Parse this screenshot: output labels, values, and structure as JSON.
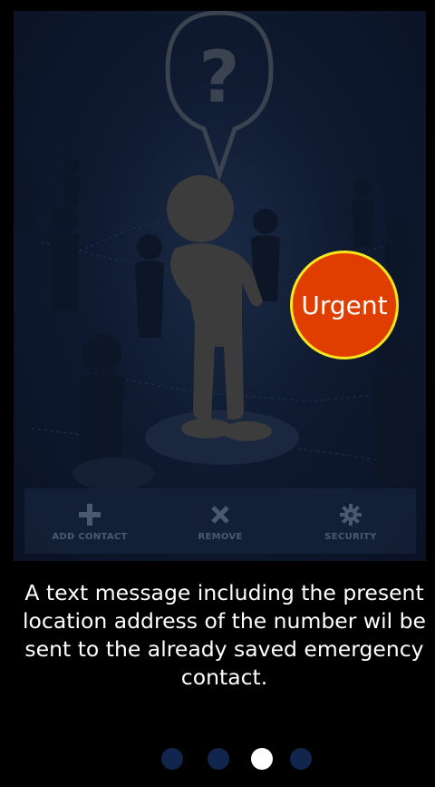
{
  "onboarding": {
    "urgent_label": "Urgent",
    "description": "A text message including the present location address of the number wil be sent to the already saved emergency contact.",
    "page_indicator": {
      "total": 4,
      "current": 3
    }
  },
  "toolbar": {
    "items": [
      {
        "label": "ADD CONTACT",
        "icon": "plus-icon"
      },
      {
        "label": "REMOVE",
        "icon": "close-icon"
      },
      {
        "label": "SECURITY",
        "icon": "gear-icon"
      }
    ]
  },
  "colors": {
    "urgent_fill": "#e03e00",
    "urgent_border": "#f6e71b",
    "dot_inactive": "#12264d",
    "dot_active": "#ffffff"
  }
}
